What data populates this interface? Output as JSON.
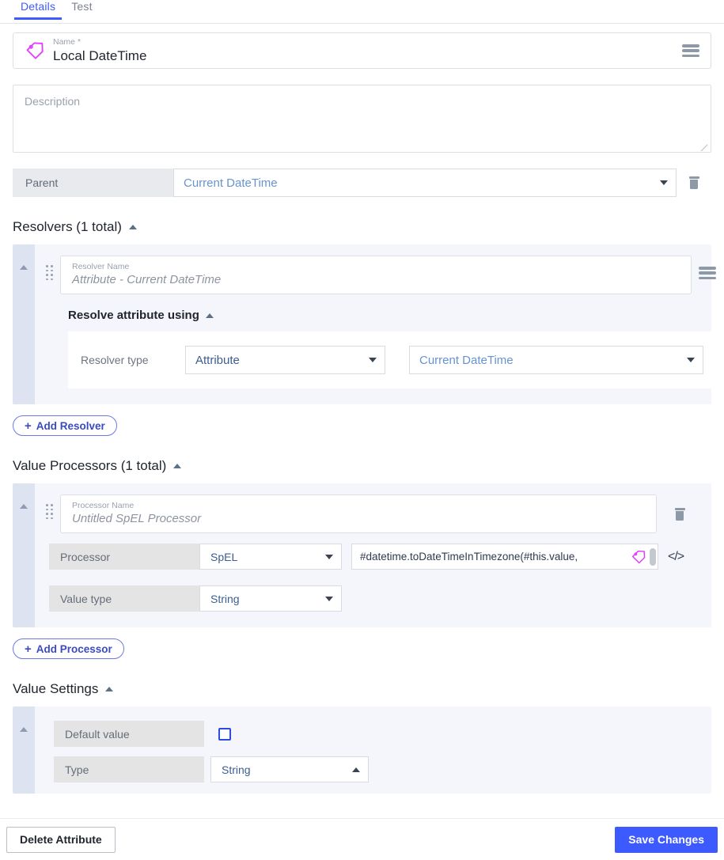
{
  "tabs": [
    {
      "label": "Details",
      "active": true
    },
    {
      "label": "Test",
      "active": false
    }
  ],
  "name_field": {
    "caption": "Name",
    "required_mark": "*",
    "value": "Local DateTime",
    "icon": "tag-icon",
    "menu_icon": "hamburger-menu-icon"
  },
  "description": {
    "placeholder": "Description",
    "value": ""
  },
  "parent": {
    "label": "Parent",
    "value": "Current DateTime",
    "delete_icon": "trash-icon"
  },
  "resolvers": {
    "heading": "Resolvers (1 total)",
    "item": {
      "name_caption": "Resolver Name",
      "name_placeholder": "Attribute - Current DateTime",
      "menu_icon": "hamburger-menu-icon",
      "sub_heading": "Resolve attribute using",
      "type_label": "Resolver type",
      "type_value": "Attribute",
      "target_value": "Current DateTime"
    },
    "add_button": "Add Resolver",
    "add_plus": "+"
  },
  "value_processors": {
    "heading": "Value Processors (1 total)",
    "item": {
      "name_caption": "Processor Name",
      "name_placeholder": "Untitled SpEL Processor",
      "delete_icon": "trash-icon",
      "processor_label": "Processor",
      "processor_value": "SpEL",
      "expression_value": "#datetime.toDateTimeInTimezone(#this.value,",
      "expression_tag_icon": "tag-icon",
      "code_icon": "</>",
      "value_type_label": "Value type",
      "value_type_value": "String"
    },
    "add_button": "Add Processor",
    "add_plus": "+"
  },
  "value_settings": {
    "heading": "Value Settings",
    "default_value_label": "Default value",
    "default_value_checked": false,
    "type_label": "Type",
    "type_value": "String"
  },
  "footer": {
    "delete_label": "Delete Attribute",
    "save_label": "Save Changes"
  },
  "colors": {
    "accent": "#3d5afe",
    "tag": "#e040fb",
    "label_bg": "#e4e4e4",
    "card_bg": "#f4f6fb",
    "rail_bg": "#dde3f0"
  }
}
